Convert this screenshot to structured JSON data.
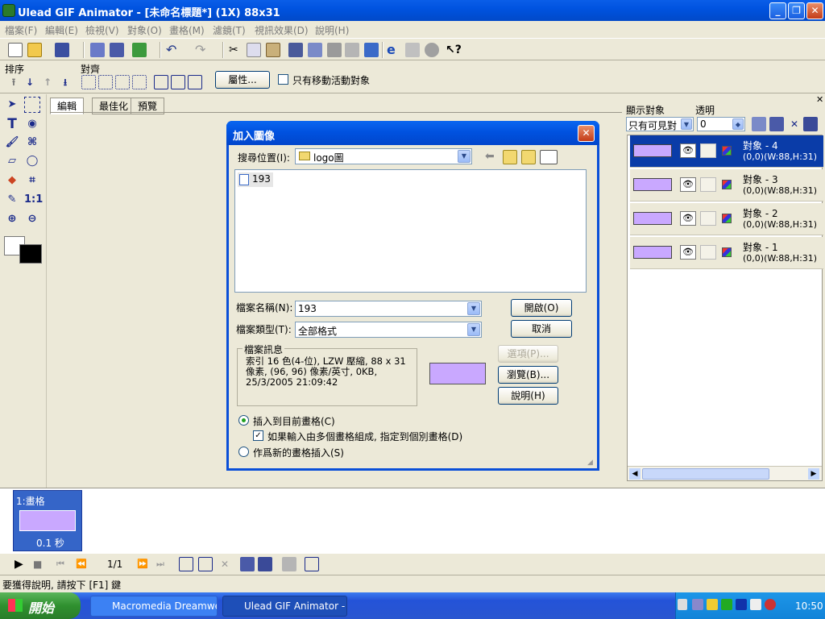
{
  "window": {
    "title": "Ulead GIF Animator - [未命名標題*] (1X) 88x31",
    "min": "_",
    "max": "❐",
    "close": "✕"
  },
  "menu": [
    "檔案(F)",
    "編輯(E)",
    "檢視(V)",
    "對象(O)",
    "畫格(M)",
    "濾鏡(T)",
    "視訊效果(D)",
    "說明(H)"
  ],
  "toolbar2": {
    "order_label": "排序",
    "align_label": "對齊",
    "properties_button": "屬性...",
    "only_moving_label": "只有移動活動對象"
  },
  "tabs": [
    "編輯",
    "最佳化",
    "預覽"
  ],
  "right_panel": {
    "show_label": "顯示對象",
    "transparency_label": "透明",
    "show_select_value": "只有可見對",
    "transparency_value": "0",
    "objects": [
      {
        "name": "對象 - 4",
        "info": "(0,0)(W:88,H:31)"
      },
      {
        "name": "對象 - 3",
        "info": "(0,0)(W:88,H:31)"
      },
      {
        "name": "對象 - 2",
        "info": "(0,0)(W:88,H:31)"
      },
      {
        "name": "對象 - 1",
        "info": "(0,0)(W:88,H:31)"
      }
    ]
  },
  "frames": {
    "frame1_label": "1:畫格",
    "frame1_time": "0.1 秒",
    "counter": "1/1"
  },
  "status": "要獲得說明, 請按下 [F1] 鍵",
  "taskbar": {
    "start": "開始",
    "task1": "Macromedia Dreamwe...",
    "task2": "Ulead GIF Animator - ...",
    "clock": "10:50"
  },
  "dialog": {
    "title": "加入圖像",
    "look_in_label": "搜尋位置(I):",
    "look_in_value": "logo圖",
    "file_item": "193",
    "filename_label": "檔案名稱(N):",
    "filename_value": "193",
    "filetype_label": "檔案類型(T):",
    "filetype_value": "全部格式",
    "open_button": "開啟(O)",
    "cancel_button": "取消",
    "fileinfo_label": "檔案訊息",
    "fileinfo_text": "索引 16 色(4-位), LZW 壓縮, 88 x 31 像素, (96, 96) 像素/英寸, 0KB, 25/3/2005 21:09:42",
    "options_button": "選項(P)...",
    "browse_button": "瀏覽(B)...",
    "help_button": "說明(H)",
    "radio_insert_current": "插入到目前畫格(C)",
    "check_multi": "如果輸入由多個畫格組成, 指定到個別畫格(D)",
    "radio_insert_new": "作爲新的畫格插入(S)"
  }
}
